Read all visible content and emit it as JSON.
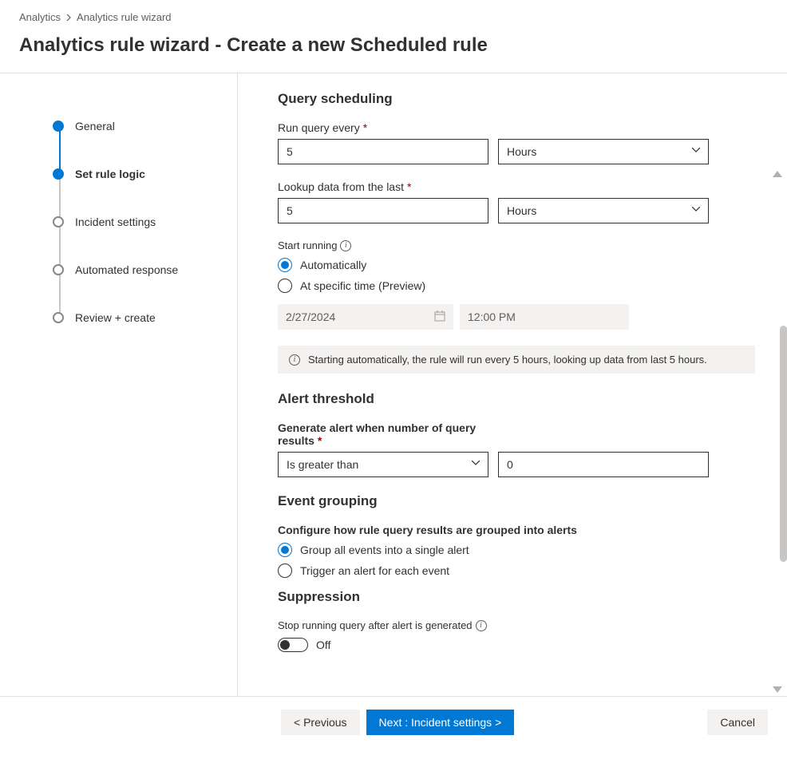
{
  "breadcrumb": {
    "parent": "Analytics",
    "current": "Analytics rule wizard"
  },
  "page_title": "Analytics rule wizard - Create a new Scheduled rule",
  "steps": [
    {
      "label": "General",
      "state": "done"
    },
    {
      "label": "Set rule logic",
      "state": "active"
    },
    {
      "label": "Incident settings",
      "state": "pending"
    },
    {
      "label": "Automated response",
      "state": "pending"
    },
    {
      "label": "Review + create",
      "state": "pending"
    }
  ],
  "sections": {
    "scheduling": {
      "title": "Query scheduling",
      "run_every": {
        "label": "Run query every",
        "value": "5",
        "unit_selected": "Hours"
      },
      "lookup": {
        "label": "Lookup data from the last",
        "value": "5",
        "unit_selected": "Hours"
      },
      "start_running": {
        "label": "Start running",
        "options": {
          "auto": "Automatically",
          "specific": "At specific time (Preview)"
        },
        "selected": "auto",
        "date": "2/27/2024",
        "time": "12:00 PM"
      },
      "info_banner": "Starting automatically, the rule will run every 5 hours, looking up data from last 5 hours."
    },
    "threshold": {
      "title": "Alert threshold",
      "label": "Generate alert when number of query results",
      "operator_selected": "Is greater than",
      "value": "0"
    },
    "grouping": {
      "title": "Event grouping",
      "desc": "Configure how rule query results are grouped into alerts",
      "options": {
        "single": "Group all events into a single alert",
        "each": "Trigger an alert for each event"
      },
      "selected": "single"
    },
    "suppression": {
      "title": "Suppression",
      "label": "Stop running query after alert is generated",
      "state_text": "Off"
    }
  },
  "footer": {
    "prev": "< Previous",
    "next": "Next : Incident settings >",
    "cancel": "Cancel"
  }
}
